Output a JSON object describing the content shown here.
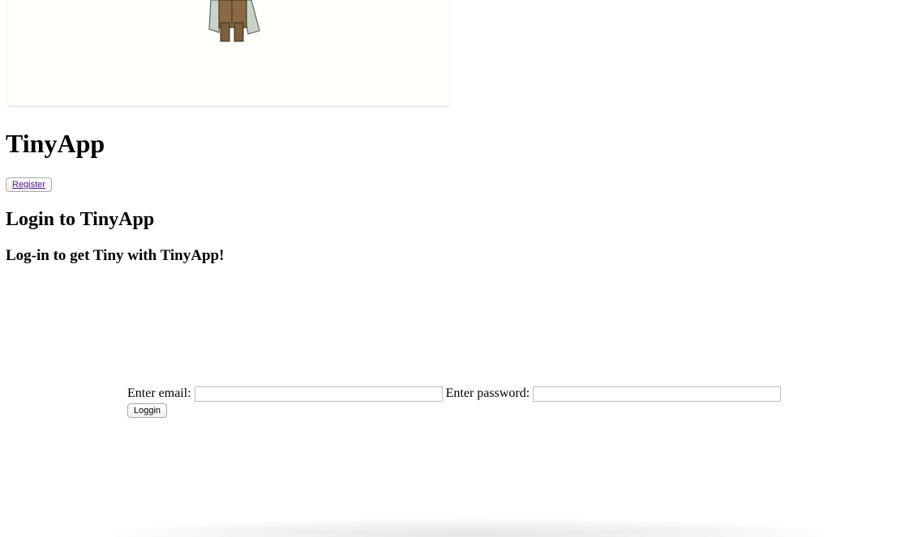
{
  "header": {
    "logo_icon": "cartoon-figure-icon",
    "title": "TinyApp",
    "register_label": "Register"
  },
  "login": {
    "heading": "Login to TinyApp",
    "subheading": "Log-in to get Tiny with TinyApp!",
    "email_label": "Enter email:",
    "email_value": "",
    "password_label": "Enter password:",
    "password_value": "",
    "submit_label": "Loggin"
  }
}
